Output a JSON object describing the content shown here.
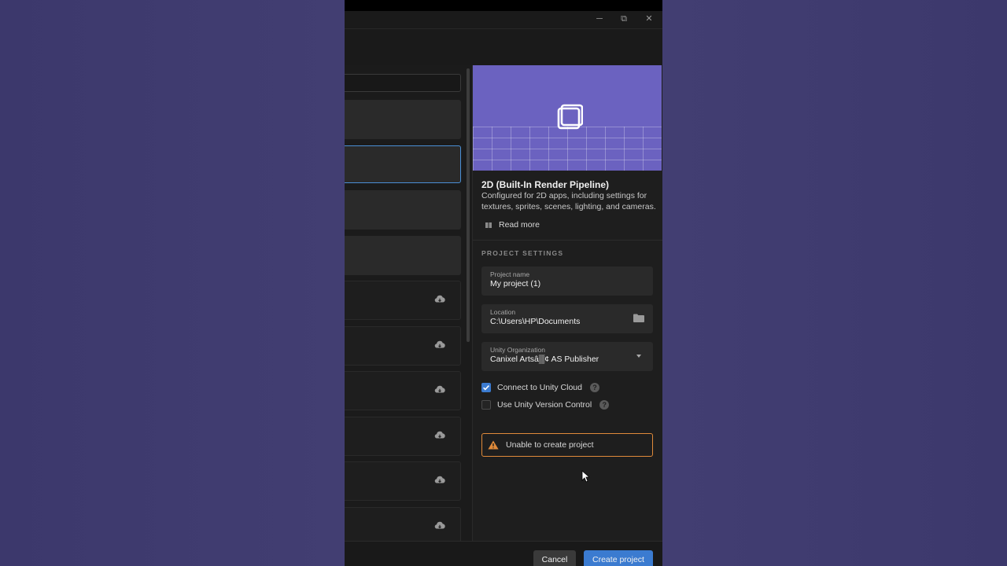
{
  "window": {
    "minimize_glyph": "─",
    "maximize_glyph": "⧉",
    "close_glyph": "✕"
  },
  "template": {
    "title": "2D (Built-In Render Pipeline)",
    "description": "Configured for 2D apps, including settings for textures, sprites, scenes, lighting, and cameras.",
    "read_more_label": "Read more",
    "preview_color": "#6b62c0"
  },
  "settings": {
    "section_label": "PROJECT SETTINGS",
    "project_name": {
      "label": "Project name",
      "value": "My project (1)"
    },
    "location": {
      "label": "Location",
      "value": "C:\\Users\\HP\\Documents",
      "icon": "folder-icon"
    },
    "organization": {
      "label": "Unity Organization",
      "value": "Canixel Artsâ▒¢ AS Publisher"
    },
    "connect_cloud": {
      "label": "Connect to Unity Cloud",
      "checked": true
    },
    "version_control": {
      "label": "Use Unity Version Control",
      "checked": false
    },
    "help_glyph": "?"
  },
  "warning": {
    "text": "Unable to create project",
    "color": "#e08a3a"
  },
  "footer": {
    "cancel_label": "Cancel",
    "create_label": "Create project",
    "accent": "#3b7bd0"
  },
  "template_list": {
    "cloud_icon": "cloud-download-icon"
  }
}
